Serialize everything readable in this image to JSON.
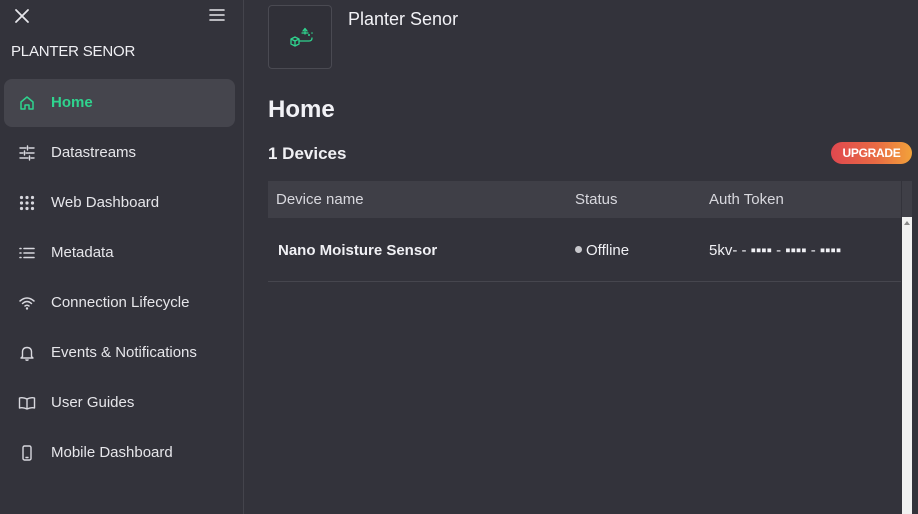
{
  "sidebar": {
    "brand": "PLANTER SENOR",
    "items": [
      {
        "label": "Home",
        "icon": "home-icon",
        "active": true
      },
      {
        "label": "Datastreams",
        "icon": "datastreams-icon"
      },
      {
        "label": "Web Dashboard",
        "icon": "grid-icon"
      },
      {
        "label": "Metadata",
        "icon": "list-icon"
      },
      {
        "label": "Connection Lifecycle",
        "icon": "wifi-icon"
      },
      {
        "label": "Events & Notifications",
        "icon": "bell-icon"
      },
      {
        "label": "User Guides",
        "icon": "book-icon"
      },
      {
        "label": "Mobile Dashboard",
        "icon": "mobile-icon"
      }
    ]
  },
  "header": {
    "product_name": "Planter Senor"
  },
  "main": {
    "title": "Home",
    "devices_count": "1 Devices",
    "upgrade_label": "UPGRADE"
  },
  "table": {
    "columns": [
      "Device name",
      "Status",
      "Auth Token"
    ],
    "rows": [
      {
        "name": "Nano Moisture Sensor",
        "status": "Offline",
        "token": "5kv- - ▪▪▪▪ - ▪▪▪▪ - ▪▪▪▪"
      }
    ]
  },
  "colors": {
    "accent": "#2fd38e",
    "background": "#33333b",
    "upgrade_start": "#e0484f",
    "upgrade_end": "#f2a23a"
  }
}
